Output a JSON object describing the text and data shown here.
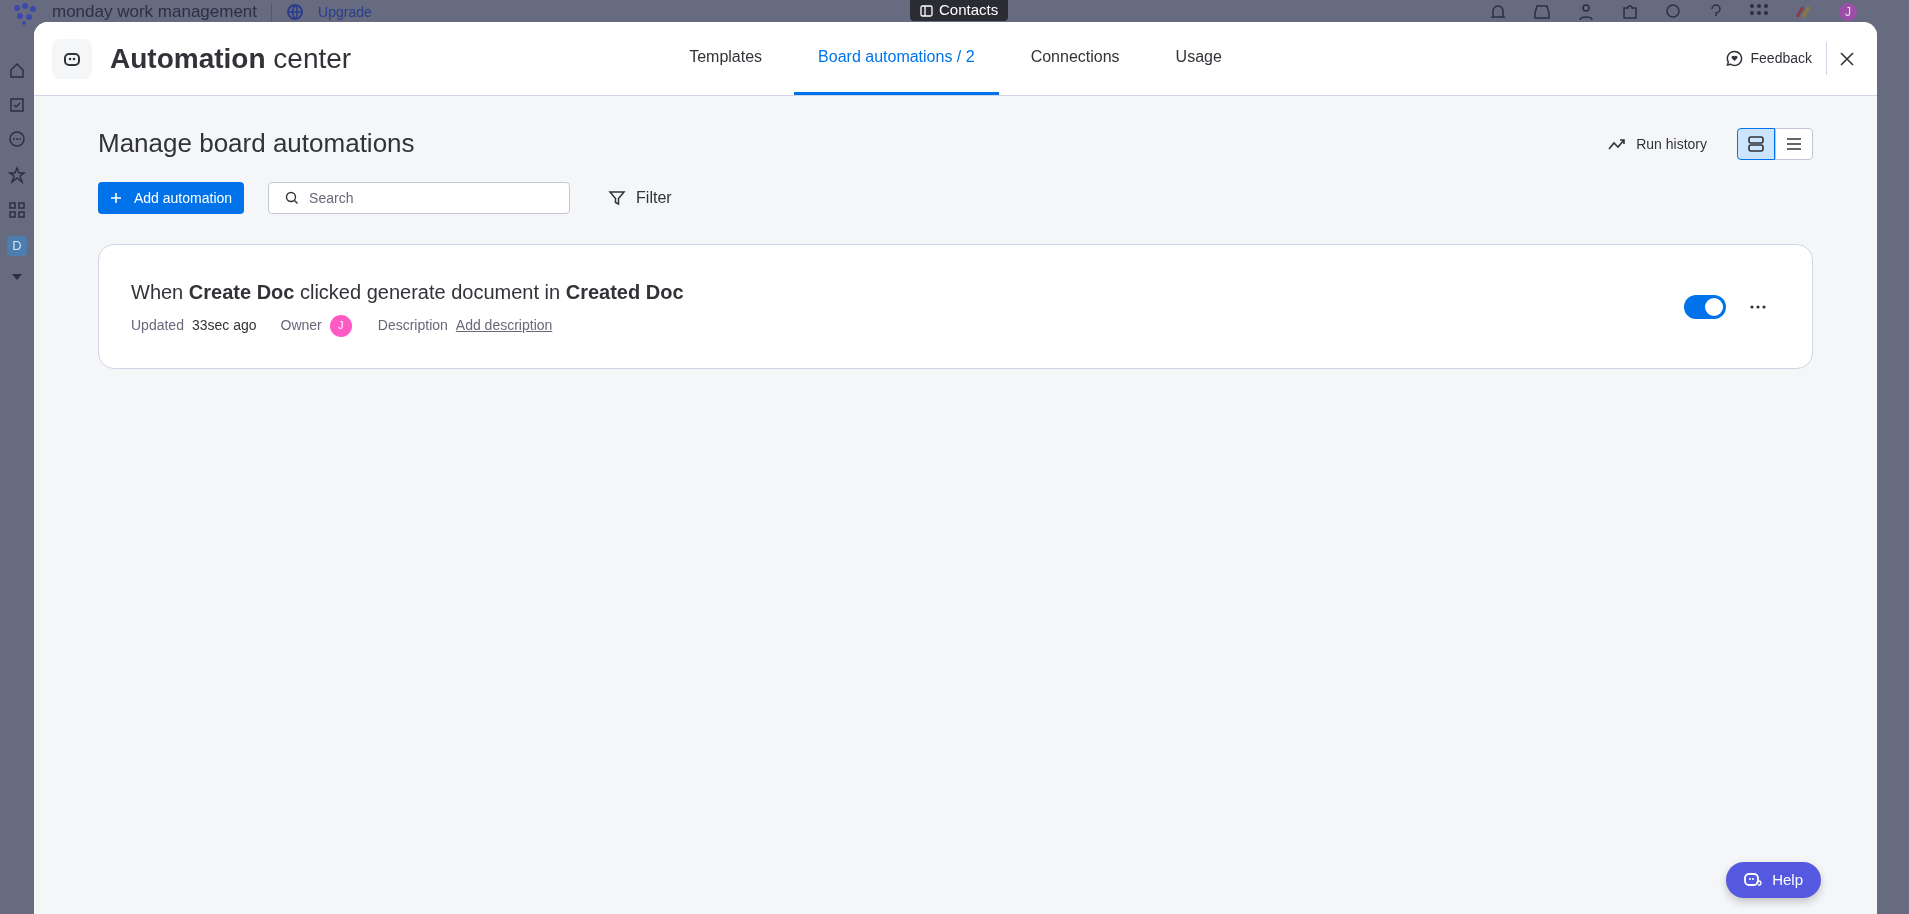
{
  "app": {
    "brand": "monday work management",
    "upgrade": "Upgrade",
    "workspace_badge": "D",
    "avatar": "J"
  },
  "tooltip": "Contacts",
  "modal": {
    "title": "**Automation** center",
    "tabs": [
      {
        "label": "Templates",
        "selected": false
      },
      {
        "label": "Board automations / 2",
        "selected": true
      },
      {
        "label": "Connections",
        "selected": false
      },
      {
        "label": "Usage",
        "selected": false
      }
    ],
    "feedback": "Feedback",
    "heading": "Manage board automations",
    "run_history": "Run history",
    "views": [
      {
        "kind": "cards",
        "selected": true
      },
      {
        "kind": "list",
        "selected": false
      }
    ],
    "add_button": "Add automation",
    "search": {
      "placeholder": "Search"
    },
    "filter": "Filter",
    "automations": [
      {
        "sentence": "When **Create Doc** clicked generate document in **Created Doc**",
        "updated_label": "Updated",
        "updated": "33sec ago",
        "owner_label": "Owner",
        "owner_initial": "J",
        "description_label": "Description",
        "description_placeholder": "Add description",
        "on": true
      }
    ],
    "help": "Help"
  }
}
